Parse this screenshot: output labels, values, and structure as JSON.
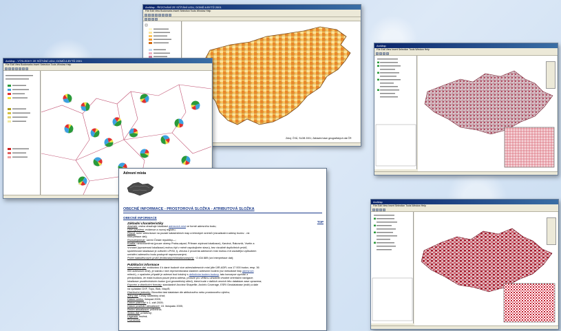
{
  "screenshots": {
    "map_orange": {
      "title": "ArcMap - ŘEZOVÁNÍ ZE SČÍTÁNÍ LIDU, DOMŮ A BYTŮ 2001",
      "menu": "File Edit View Bookmarks Insert Selection Tools Window Help",
      "caption": "Zdroj: ČSÚ, SLDB 2001; Základní báze geografických dat ČR"
    },
    "map_pies": {
      "title": "ArcMap - VÝSLEDKY ZE SČÍTÁNÍ LIDU, DOMŮ A BYTŮ 2001",
      "menu": "File Edit View Bookmarks Insert Selection Tools Window Help",
      "caption": "Zdroj: ČSÚ, SLDB 2001"
    },
    "map_cz_top": {
      "title": "ArcMap",
      "menu": "File Edit View Insert Selection Tools Window Help"
    },
    "map_cz_bottom": {
      "title": "ArcMap",
      "menu": "File Edit View Insert Selection Tools Window Help"
    }
  },
  "document": {
    "title": "Adresní místa",
    "heading": "OBECNÉ INFORMACE - PROSTOROVÁ SLOŽKA - ATRIBUTOVÁ SLOŽKA",
    "section": "OBECNÉ INFORMACE",
    "top_link": "TOP",
    "basic_heading": "Základní charakteristiky",
    "basic_lines": [
      {
        "label": "Abstrakt:",
        "text": " vrstva obsahuje lokalizaci ",
        "link": "adresních míst",
        "rest": " ve formě adresního bodu;"
      },
      {
        "label": "Účel vytvoření:",
        "text": " evidence a rozvoj registru;",
        "link": "",
        "rest": ""
      },
      {
        "label": "Původ:",
        "text": " ruční vektorizace na pozadí katastrálních map a leteckých snímků (vizualizační adresy budov - viz",
        "link": "",
        "rest": ""
      },
      {
        "label": "",
        "text": "Interpretace dat);",
        "link": "",
        "rest": ""
      },
      {
        "label": "Rozsah/pokrytí:",
        "text": " území České republiky—;",
        "link": "",
        "rest": ""
      },
      {
        "label": "Kvalita:",
        "text": " nerovnoměrná (pouze okresy Praha-západ, Příbram zúplnost lokalizace), Karviná, Rakovník, Vsetín a",
        "link": "",
        "rest": ""
      },
      {
        "label": "",
        "text": "Vrchlabí (upravenost lokalizace) mohou být v méně uspokojivém stavu), bez vizuálně duplicitních prvků,",
        "link": "",
        "rest": ""
      },
      {
        "label": "",
        "text": "spolehlivostí lokalizace je ovlivněn LPIS0, tj. zhruba 2 procenta adresních míst mohou mít zavádějící způsobem",
        "link": "",
        "rest": ""
      },
      {
        "label": "",
        "text": "umístění adresního bodu postupně napravovanými;",
        "link": "",
        "rest": ""
      },
      {
        "label": "Počet nadodesových prvků (evidovaných/lokalizovaných):",
        "text": " ~2 434 889 (viz Interpretace dat);",
        "link": "",
        "rest": ""
      }
    ],
    "pub_heading": "Publikační informace",
    "pub_lines": [
      {
        "label": "Interpretace dat:",
        "text": " evidováno 4 k dané budově více adres/adresních míst (dle ÚIR-ADR; cca 17 000 budov, resp. 36",
        "link": "",
        "rest": ""
      },
      {
        "label": "",
        "text": "000 adresních míst), je každá z nich reprezentována vlastním adresním bodem (viz metodické listy ",
        "link": "adresních",
        "rest": ""
      },
      {
        "label": "",
        "text": "",
        "link": "",
        "rest": "mítech), v opačném případě je adresní bod totožný s ",
        "link2": "definičním bodem budovy",
        "rest2": ", tato koncepce vychází z"
      },
      {
        "label": "",
        "text": "předpokladu, že malá budova pouze jedna adresa, protože pro většinu uživatelů vhodné orientační navigace;",
        "link": "",
        "rest": ""
      },
      {
        "label": "",
        "text": "lokalizace prostřednictvím budov (pol geometrický střed), která bude v dalších verzích této databáze zase upravena;",
        "link": "",
        "rest": ""
      },
      {
        "label": "Exportní a distribuční formáty:",
        "text": " standardně Arcview Shapefile, ArcInfo Coverage, ESRI Geodatabase (mdb) a dále",
        "link": "",
        "rest": ""
      },
      {
        "label": "",
        "text": "na vyžádání DXF, Topo, Bick, MapIS;",
        "link": "",
        "rest": ""
      },
      {
        "label": "Distribuční jednotky:",
        "text": " Bionvitrá část databáze dle atributového nebo prostorového výběru;",
        "link": "",
        "rest": ""
      },
      {
        "label": "Zdroj dat:",
        "text": " Český statistický úřad;",
        "link": "",
        "rest": ""
      },
      {
        "label": "Datum vzniku:",
        "text": " listopad 2005;",
        "link": "",
        "rest": ""
      },
      {
        "label": "Datum platnosti:",
        "text": " k 1. září 2005;",
        "link": "",
        "rest": ""
      },
      {
        "label": "Datum poslední aktualizace:",
        "text": " 15. listopadu 2005;",
        "link": "",
        "rest": ""
      },
      {
        "label": "Režim aktualizace:",
        "text": " průběžná;",
        "link": "",
        "rest": ""
      },
      {
        "label": "Status dat:",
        "text": " průběžný;",
        "link": "",
        "rest": ""
      },
      {
        "label": "Legenda:",
        "text": " možná;",
        "link": "",
        "rest": ""
      },
      {
        "label": "Poznámka:",
        "text": "",
        "link": "",
        "rest": ""
      }
    ]
  },
  "colors": {
    "background": "#cfe0f2",
    "titlebar": "#0a246a",
    "link": "#1a3a8a",
    "map_orange": "#e8902a",
    "map_red": "#b0182a"
  }
}
